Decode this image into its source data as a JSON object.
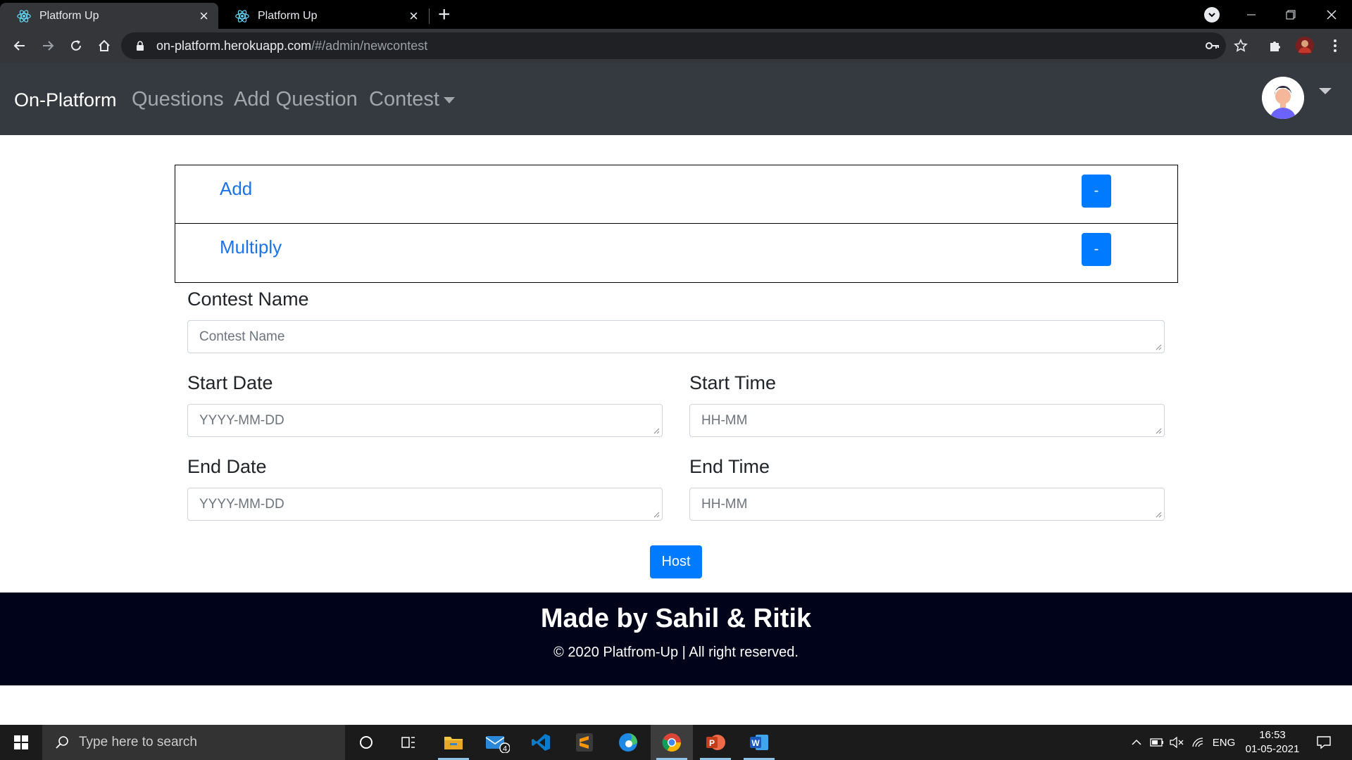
{
  "browser": {
    "tabs": [
      {
        "title": "Platform Up",
        "active": true
      },
      {
        "title": "Platform Up",
        "active": false
      }
    ],
    "url_host": "on-platform.herokuapp.com",
    "url_path": "/#/admin/newcontest"
  },
  "navbar": {
    "brand": "On-Platform",
    "links": [
      "Questions",
      "Add Question",
      "Contest"
    ]
  },
  "questions": [
    {
      "title": "Add",
      "remove_label": "-"
    },
    {
      "title": "Multiply",
      "remove_label": "-"
    }
  ],
  "form": {
    "contest_name": {
      "label": "Contest Name",
      "placeholder": "Contest Name"
    },
    "start_date": {
      "label": "Start Date",
      "placeholder": "YYYY-MM-DD"
    },
    "start_time": {
      "label": "Start Time",
      "placeholder": "HH-MM"
    },
    "end_date": {
      "label": "End Date",
      "placeholder": "YYYY-MM-DD"
    },
    "end_time": {
      "label": "End Time",
      "placeholder": "HH-MM"
    },
    "submit_label": "Host"
  },
  "footer": {
    "title": "Made by Sahil & Ritik",
    "copyright": "© 2020 Platfrom-Up | All right reserved."
  },
  "taskbar": {
    "search_placeholder": "Type here to search",
    "mail_badge": "4",
    "language": "ENG",
    "time": "16:53",
    "date": "01-05-2021"
  },
  "colors": {
    "navbar_bg": "#343a40",
    "primary": "#007bff",
    "link": "#1a73e8",
    "footer_bg": "#000319"
  }
}
